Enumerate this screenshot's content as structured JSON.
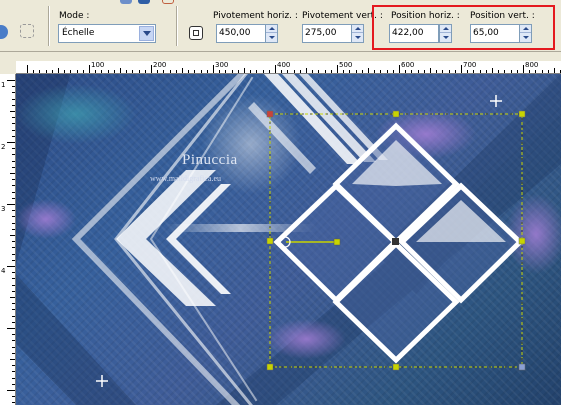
{
  "toolbar": {
    "mode": {
      "label": "Mode :",
      "value": "Échelle"
    },
    "rotation_h": {
      "label": "Pivotement horiz. :",
      "value": "450,00"
    },
    "rotation_v": {
      "label": "Pivotement vert. :",
      "value": "275,00"
    },
    "position_h": {
      "label": "Position horiz. :",
      "value": "422,00"
    },
    "position_v": {
      "label": "Position vert. :",
      "value": "65,00"
    }
  },
  "ruler": {
    "top_labels": [
      "100",
      "200",
      "300",
      "400",
      "500",
      "600",
      "700",
      "800"
    ],
    "left_labels": [
      "1",
      "2",
      "3",
      "4"
    ]
  },
  "canvas": {
    "watermark_title": "Pinuccia",
    "watermark_url": "www.maildigrafica.eu"
  },
  "colors": {
    "highlight": "#e4191f",
    "selection": "#c8d400",
    "window_bg": "#ece9d8"
  }
}
